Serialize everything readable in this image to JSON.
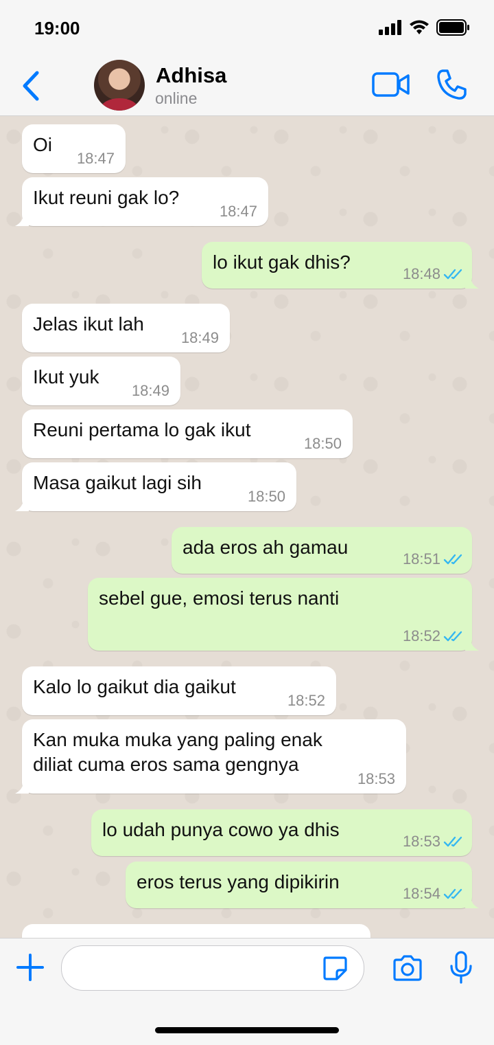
{
  "status_bar": {
    "time": "19:00"
  },
  "header": {
    "contact_name": "Adhisa",
    "presence": "online"
  },
  "colors": {
    "accent": "#007aff",
    "incoming": "#ffffff",
    "outgoing": "#dcf8c6",
    "read_tick": "#34b7f1"
  },
  "messages": [
    {
      "text": "Oi",
      "time": "18:47",
      "direction": "incoming"
    },
    {
      "text": "Ikut reuni gak lo?",
      "time": "18:47",
      "direction": "incoming"
    },
    {
      "text": "lo ikut gak dhis?",
      "time": "18:48",
      "direction": "outgoing",
      "status": "read"
    },
    {
      "text": "Jelas ikut lah",
      "time": "18:49",
      "direction": "incoming"
    },
    {
      "text": "Ikut yuk",
      "time": "18:49",
      "direction": "incoming"
    },
    {
      "text": "Reuni pertama lo gak ikut",
      "time": "18:50",
      "direction": "incoming"
    },
    {
      "text": "Masa gaikut lagi sih",
      "time": "18:50",
      "direction": "incoming"
    },
    {
      "text": "ada eros ah gamau",
      "time": "18:51",
      "direction": "outgoing",
      "status": "read"
    },
    {
      "text": "sebel gue, emosi terus nanti",
      "time": "18:52",
      "direction": "outgoing",
      "status": "read"
    },
    {
      "text": "Kalo lo gaikut dia gaikut",
      "time": "18:52",
      "direction": "incoming"
    },
    {
      "text": "Kan muka muka yang paling enak\ndiliat cuma eros sama gengnya",
      "time": "18:53",
      "direction": "incoming"
    },
    {
      "text": "lo udah punya cowo ya dhis",
      "time": "18:53",
      "direction": "outgoing",
      "status": "read"
    },
    {
      "text": "eros terus yang dipikirin",
      "time": "18:54",
      "direction": "outgoing",
      "status": "read"
    },
    {
      "text": "",
      "time": "",
      "direction": "incoming"
    }
  ],
  "composer": {
    "placeholder": ""
  },
  "icons": {
    "back": "chevron-left-icon",
    "video": "video-camera-icon",
    "call": "phone-icon",
    "plus": "plus-icon",
    "sticker": "sticker-icon",
    "camera": "camera-icon",
    "mic": "microphone-icon"
  }
}
